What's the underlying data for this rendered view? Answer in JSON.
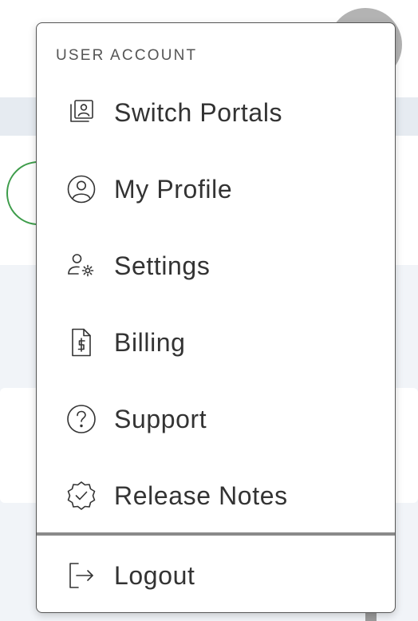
{
  "menu": {
    "header": "USER ACCOUNT",
    "items": [
      {
        "label": "Switch Portals",
        "icon": "portal-switch-icon"
      },
      {
        "label": "My Profile",
        "icon": "user-circle-icon"
      },
      {
        "label": "Settings",
        "icon": "user-settings-icon"
      },
      {
        "label": "Billing",
        "icon": "dollar-document-icon"
      },
      {
        "label": "Support",
        "icon": "question-circle-icon"
      },
      {
        "label": "Release Notes",
        "icon": "verified-badge-icon"
      }
    ],
    "logout": {
      "label": "Logout",
      "icon": "logout-icon"
    }
  },
  "colors": {
    "text": "#333333",
    "border": "#555555",
    "divider": "#8a8a8a",
    "avatar_bg": "#b3b3b3",
    "accent_green": "#3d9c4a",
    "page_bg": "#f1f4f8"
  }
}
